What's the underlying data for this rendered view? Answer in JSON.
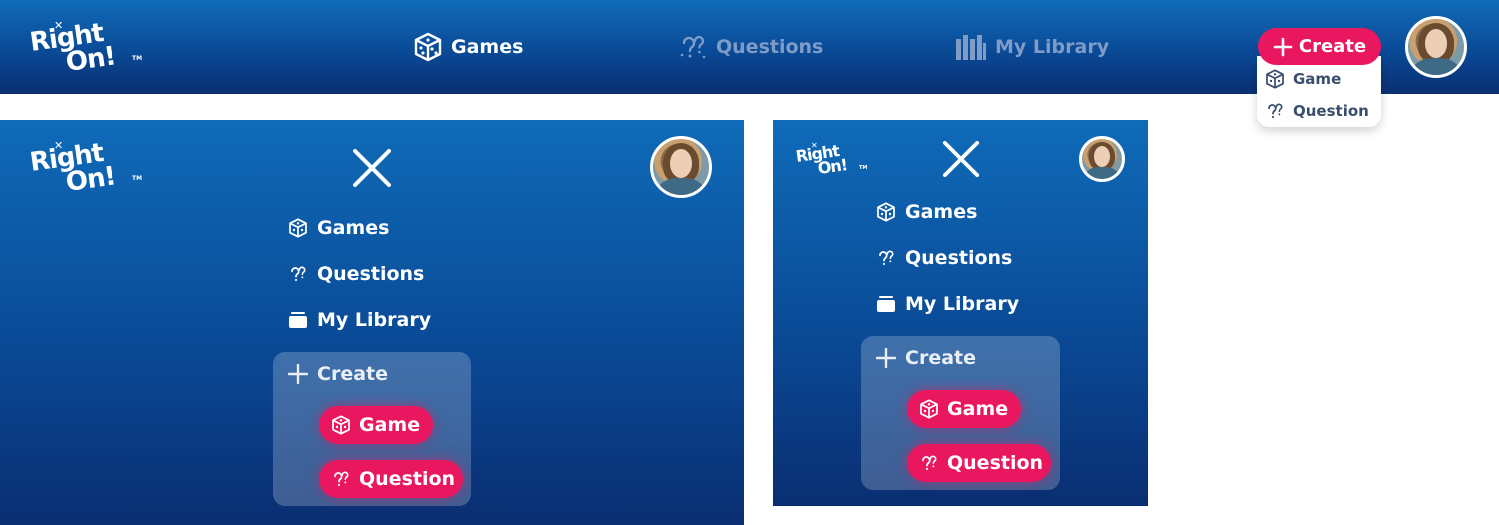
{
  "brand": {
    "logo_line1": "Right",
    "logo_line2": "On!",
    "logo_tm": "TM"
  },
  "top_nav": {
    "links": [
      {
        "label": "Games",
        "icon": "dice-icon",
        "state": "active"
      },
      {
        "label": "Questions",
        "icon": "questions-icon",
        "state": "inactive"
      },
      {
        "label": "My Library",
        "icon": "library-icon",
        "state": "inactive"
      }
    ],
    "create_label": "Create",
    "create_menu": [
      {
        "label": "Game",
        "icon": "dice-icon"
      },
      {
        "label": "Question",
        "icon": "questions-icon"
      }
    ]
  },
  "mobile_menu": {
    "items": [
      {
        "label": "Games",
        "icon": "dice-icon"
      },
      {
        "label": "Questions",
        "icon": "questions-icon"
      },
      {
        "label": "My Library",
        "icon": "library-icon"
      }
    ],
    "create_label": "Create",
    "create_options": [
      {
        "label": "Game",
        "icon": "dice-icon"
      },
      {
        "label": "Question",
        "icon": "questions-icon"
      }
    ]
  },
  "colors": {
    "nav_gradient_top": "#0f6bb8",
    "nav_gradient_bottom": "#0a2e72",
    "accent_pink": "#e8175f",
    "inactive_link": "#7f9cc6"
  }
}
